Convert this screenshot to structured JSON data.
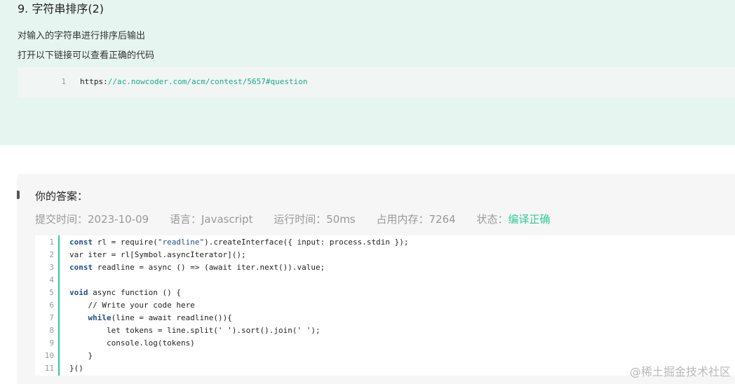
{
  "problem": {
    "title": "9. 字符串排序(2)",
    "description": "对输入的字符串进行排序后输出",
    "link_hint": "打开以下链接可以查看正确的代码",
    "link_block": {
      "line_number": "1",
      "url_proto": "https:",
      "url_rest": "//ac.nowcoder.com/acm/contest/5657#question"
    }
  },
  "answer": {
    "heading": "你的答案：",
    "meta": {
      "submit_time": "提交时间：2023-10-09",
      "language": "语言：Javascript",
      "run_time": "运行时间：50ms",
      "memory": "占用内存：7264",
      "status_label": "状态：",
      "status_value": "编译正确"
    },
    "code": {
      "line_numbers": [
        "1",
        "2",
        "3",
        "4",
        "5",
        "6",
        "7",
        "8",
        "9",
        "10",
        "11"
      ],
      "l1_kw": "const",
      "l1_a": " rl = require(",
      "l1_str": "\"readline\"",
      "l1_b": ").createInterface({ input: process.stdin });",
      "l2": "var iter = rl[Symbol.asyncIterator]();",
      "l3_kw": "const",
      "l3_a": " readline = async () => (await iter.next()).value;",
      "l5_kw": "void",
      "l5_a": " async function () {",
      "l6_cmt": "    // Write your code here",
      "l7_indent": "    ",
      "l7_kw": "while",
      "l7_a": "(line = await readline()){",
      "l8": "        let tokens = line.split(' ').sort().join(' ');",
      "l9": "        console.log(tokens)",
      "l10": "    }",
      "l11": "}()"
    }
  },
  "watermark": "@稀土掘金技术社区",
  "colors": {
    "panel_bg": "#e7f5f1",
    "accent_green": "#32ca99",
    "keyword_blue": "#1f4e8c"
  }
}
